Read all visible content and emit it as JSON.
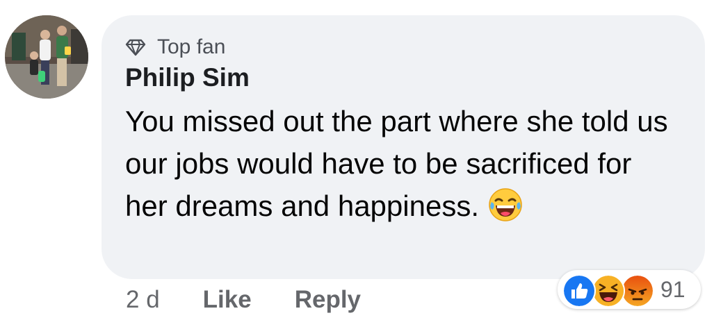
{
  "comment": {
    "badge": "Top fan",
    "author": "Philip Sim",
    "text": "You missed out the part where she told us our jobs would have to be sacrificed for her dreams and happiness.",
    "emoji": "laughing-tears-emoji"
  },
  "actions": {
    "time": "2 d",
    "like_label": "Like",
    "reply_label": "Reply"
  },
  "reactions": {
    "types": [
      "like",
      "haha",
      "angry"
    ],
    "count": "91"
  },
  "colors": {
    "bubble": "#f0f2f5",
    "like_blue": "#1877f2",
    "haha_yellow": "#f7b125",
    "angry_orange": "#e9710f",
    "muted_text": "#65676b"
  }
}
